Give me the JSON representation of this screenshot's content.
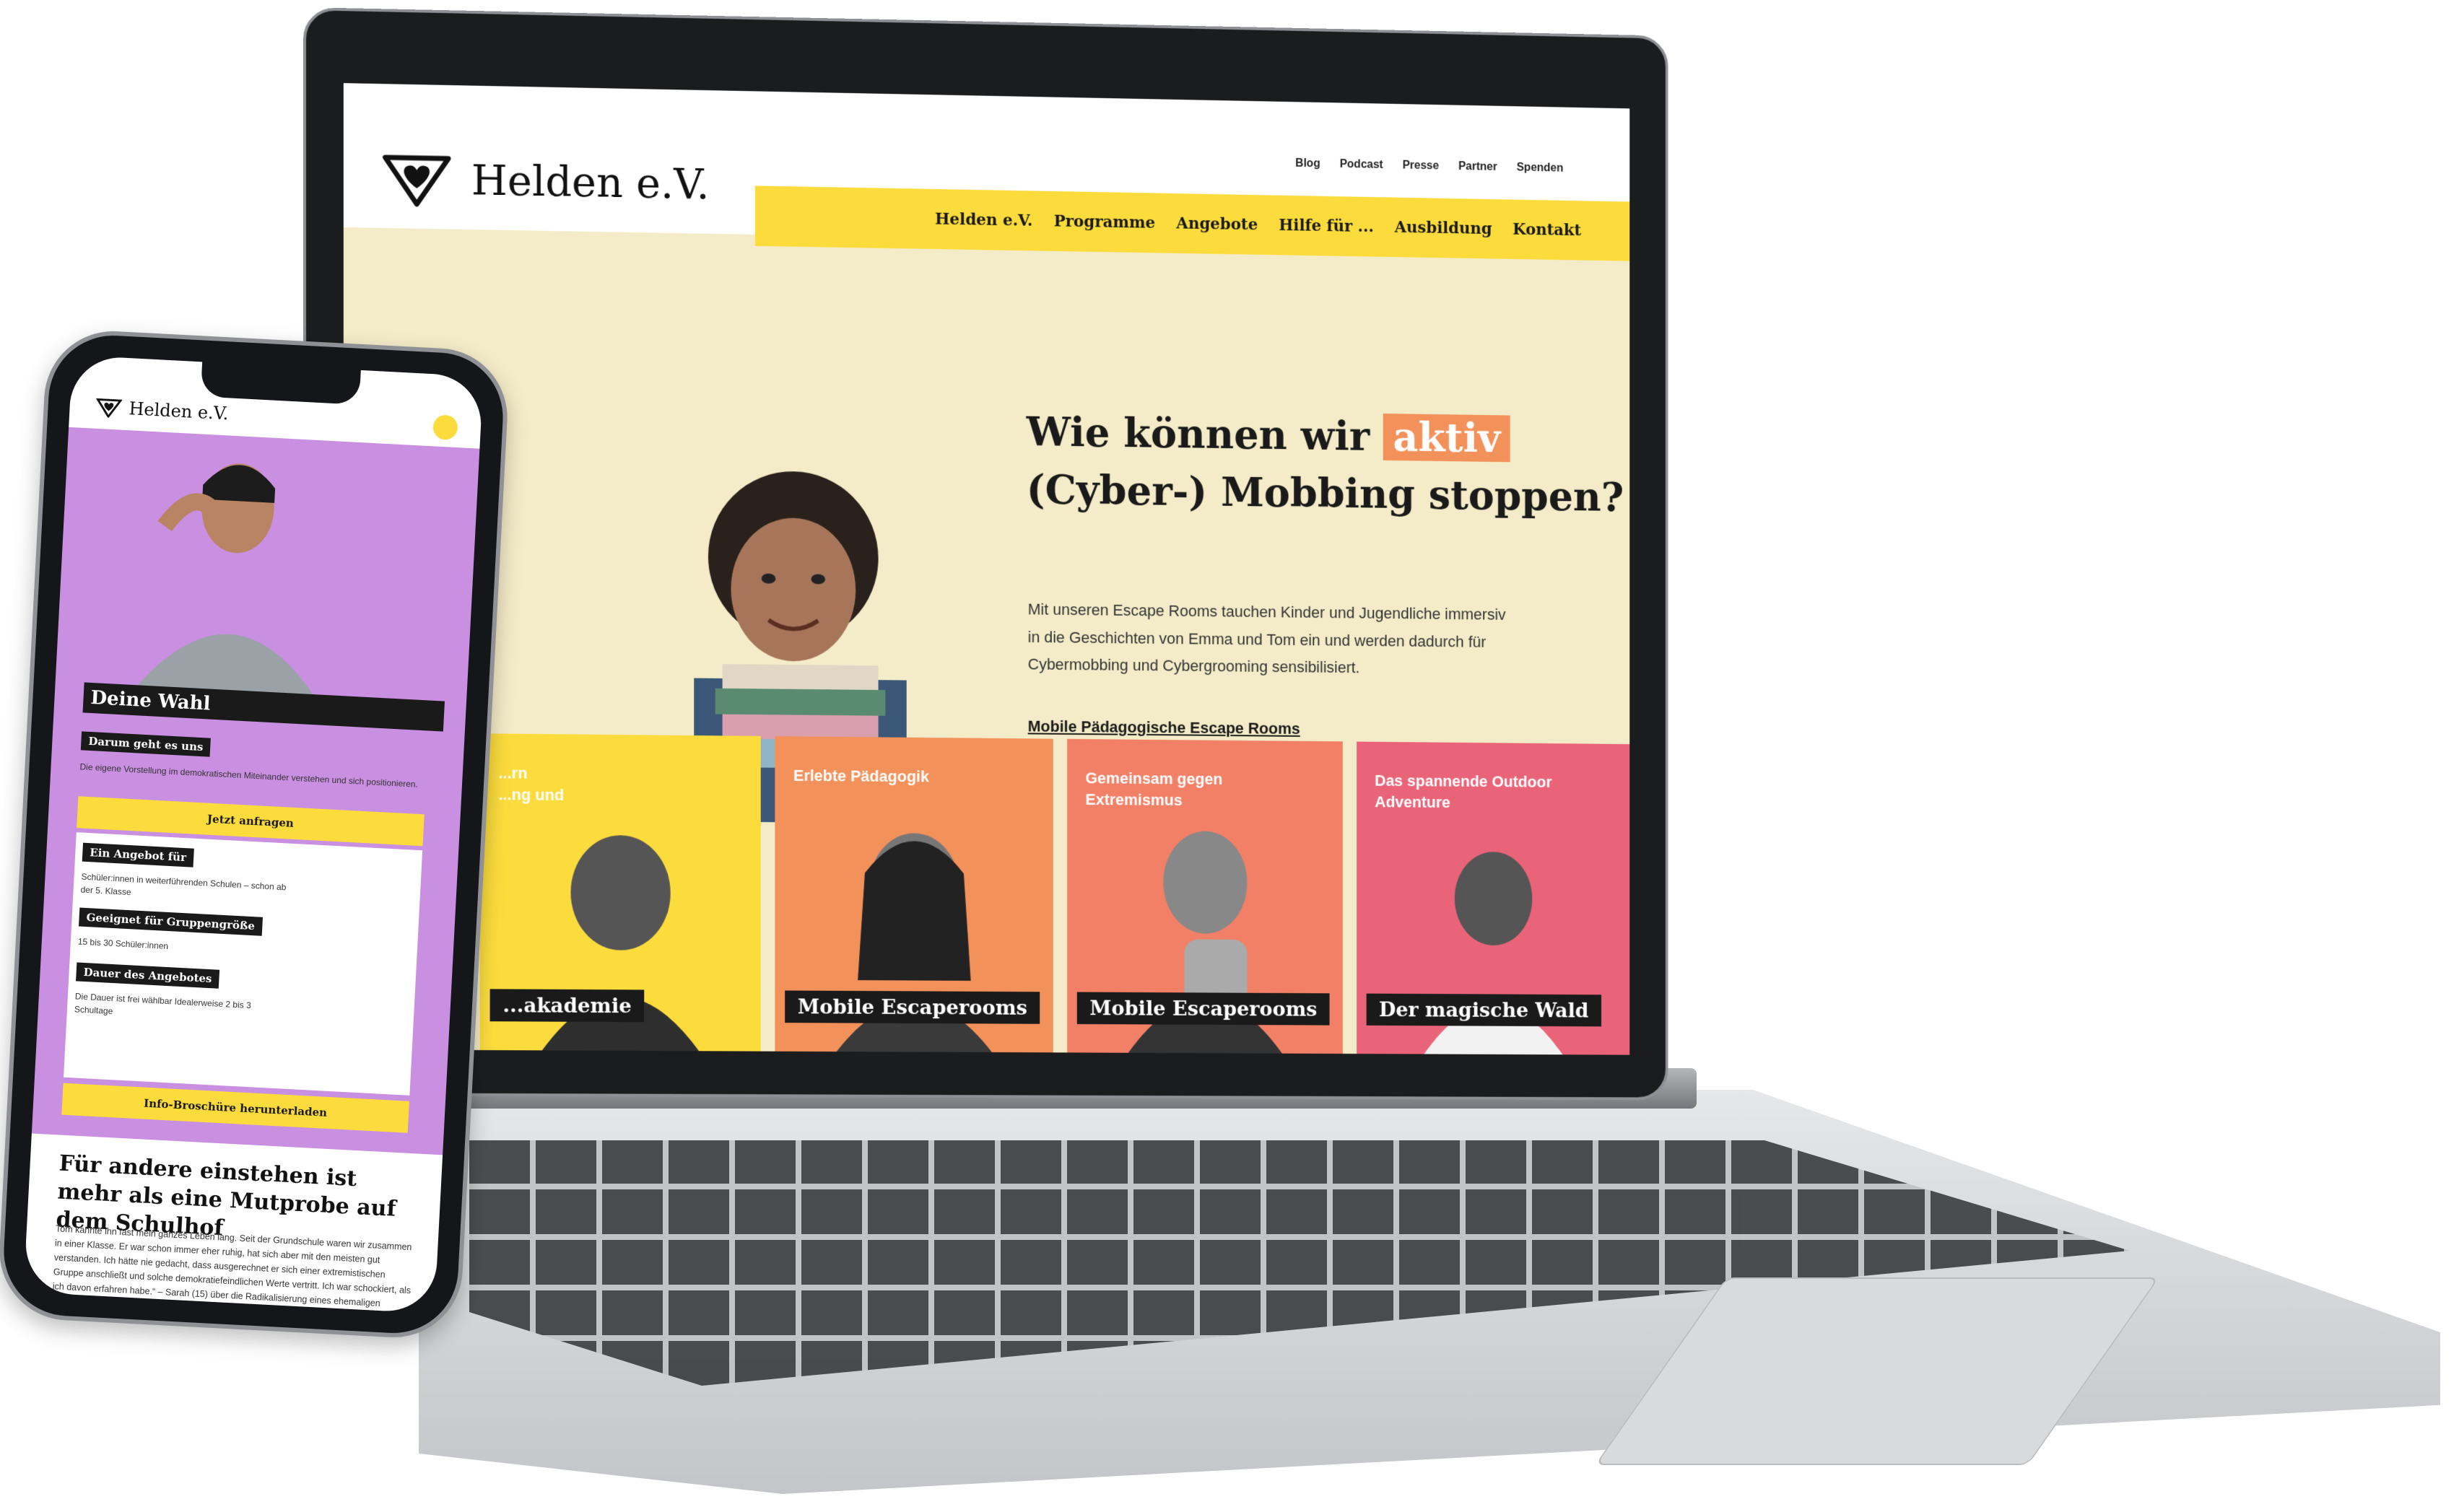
{
  "site": {
    "brand": "Helden e.V.",
    "meta_nav": [
      "Blog",
      "Podcast",
      "Presse",
      "Partner",
      "Spenden"
    ],
    "main_nav": [
      "Helden e.V.",
      "Programme",
      "Angebote",
      "Hilfe für ...",
      "Ausbildung",
      "Kontakt"
    ],
    "colors": {
      "yellow": "#fcdc3c",
      "hero_bg": "#f4ecc8",
      "orange": "#f3915a",
      "coral": "#f28066",
      "pink": "#ea6479",
      "purple": "#c98fe0"
    }
  },
  "hero": {
    "title_line1_start": "Wie können wir",
    "title_highlight": "aktiv",
    "title_line2": "(Cyber-) Mobbing stoppen?",
    "text": "Mit unseren Escape Rooms tauchen Kinder und Jugendliche immersiv in die Geschichten von Emma und Tom ein und werden dadurch für Cybermobbing und Cybergrooming sensibilisiert.",
    "link": "Mobile Pädagogische Escape Rooms"
  },
  "cards": [
    {
      "tag": "...rn\n...ng und",
      "bar": "...akademie",
      "color": "#fcdc3c"
    },
    {
      "tag": "Erlebte Pädagogik",
      "bar": "Mobile Escaperooms",
      "color": "#f3915a"
    },
    {
      "tag": "Gemeinsam gegen Extremismus",
      "bar": "Mobile Escaperooms",
      "color": "#f28066"
    },
    {
      "tag": "Das spannende Outdoor Adventure",
      "bar": "Der magische Wald",
      "color": "#ea6479"
    }
  ],
  "phone": {
    "brand": "Helden e.V.",
    "hero_title": "Deine Wahl",
    "chip1": "Darum geht es uns",
    "text1": "Die eigene Vorstellung im demokratischen Miteinander verstehen und sich positionieren.",
    "btn1": "Jetzt anfragen",
    "chip2": "Ein Angebot für",
    "text2": "Schüler:innen in weiterführenden Schulen – schon ab der 5. Klasse",
    "chip3": "Geeignet für Gruppengröße",
    "text3": "15 bis 30 Schüler:innen",
    "chip4": "Dauer des Angebotes",
    "text4": "Die Dauer ist frei wählbar Idealerweise 2 bis 3 Schultage",
    "btn2": "Info-Broschüre herunterladen",
    "article_title": "Für andere einstehen ist mehr als eine Mutprobe auf dem Schulhof",
    "article_text": "Tom kannte ihn fast mein ganzes Leben lang. Seit der Grundschule waren wir zusammen in einer Klasse. Er war schon immer eher ruhig, hat sich aber mit den meisten gut verstanden. Ich hätte nie gedacht, dass ausgerechnet er sich einer extremistischen Gruppe anschließt und solche demokratiefeindlichen Werte vertritt. Ich war schockiert, als ich davon erfahren habe.“ – Sarah (15) über die Radikalisierung eines ehemaligen Mitschülers"
  }
}
